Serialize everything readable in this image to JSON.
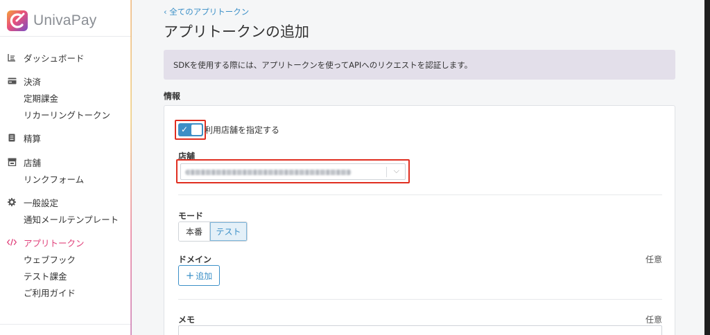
{
  "brand": {
    "name": "UnivaPay"
  },
  "sidebar": {
    "items": [
      {
        "icon": "dashboard-icon",
        "label": "ダッシュボード"
      },
      {
        "icon": "card-icon",
        "label": "決済",
        "children": [
          "定期課金",
          "リカーリングトークン"
        ]
      },
      {
        "icon": "document-icon",
        "label": "精算"
      },
      {
        "icon": "store-icon",
        "label": "店舗",
        "children": [
          "リンクフォーム"
        ]
      },
      {
        "icon": "gear-icon",
        "label": "一般設定",
        "children": [
          "通知メールテンプレート"
        ]
      },
      {
        "icon": "code-icon",
        "label": "アプリトークン",
        "active": true,
        "children": [
          "ウェブフック",
          "テスト課金",
          "ご利用ガイド"
        ]
      }
    ]
  },
  "main": {
    "breadcrumb": "‹ 全てのアプリトークン",
    "title": "アプリトークンの追加",
    "banner": "SDKを使用する際には、アプリトークンを使ってAPIへのリクエストを認証します。",
    "section_label": "情報",
    "form": {
      "toggle": {
        "label": "利用店舗を指定する",
        "checked": true
      },
      "store": {
        "label": "店舗"
      },
      "mode": {
        "label": "モード",
        "options": [
          "本番",
          "テスト"
        ],
        "selected": "テスト"
      },
      "domain": {
        "label": "ドメイン",
        "optional": "任意",
        "add_button": "追加"
      },
      "memo": {
        "label": "メモ",
        "optional": "任意"
      }
    }
  },
  "colors": {
    "accent": "#3a8fc7",
    "active_nav": "#e0407a",
    "highlight_box": "#e02d1f",
    "banner_bg": "#e3dfea"
  }
}
